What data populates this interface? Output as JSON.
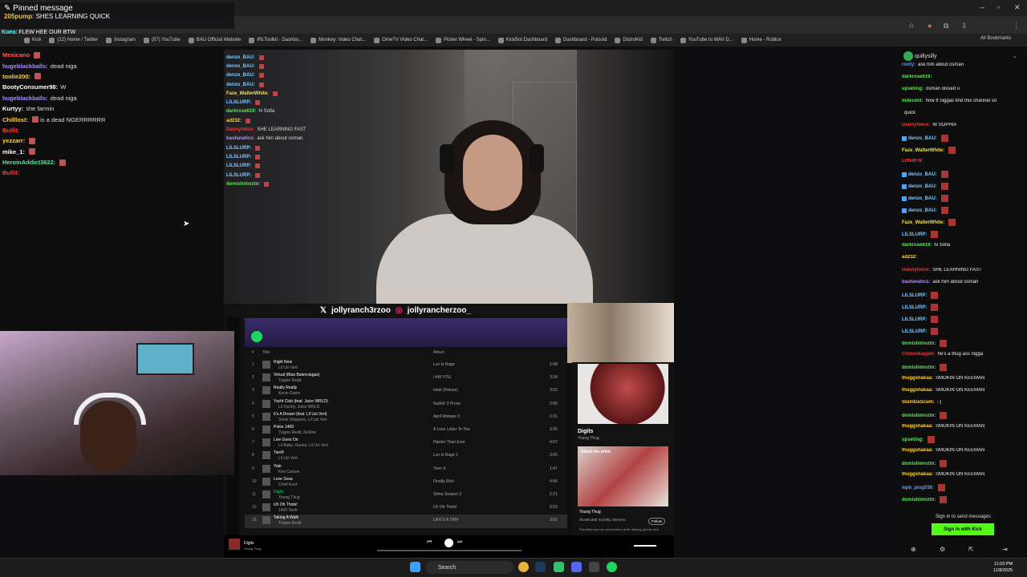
{
  "pinned": {
    "title": "Pinned message",
    "sender": "205pump",
    "text": "SHES LEARNING QUICK"
  },
  "kuea_line": {
    "sender": "Kuea:",
    "text": "FLEW HEE OUR BTW"
  },
  "bookmarks": [
    "Kick",
    "(12) Home / Twitter",
    "Instagram",
    "(57) YouTube",
    "BAU Official Website",
    "IRLToolkit - Dashbo...",
    "Monkey: Video Chat...",
    "OmeTV Video Chat...",
    "Picker Wheel - Spin...",
    "KickBot Dashboard",
    "Dashboard - Pulsoid",
    "DistroKid",
    "Twitch",
    "YouTube to WAV D...",
    "Home - Roblox"
  ],
  "all_bookmarks": "All Bookmarks",
  "left_chat": [
    {
      "name": "Mexicano",
      "text": "",
      "color": "#ff5a5a",
      "emote": true
    },
    {
      "name": "hugeblackballs:",
      "text": "dead niga",
      "color": "#a58cff",
      "emote": false
    },
    {
      "name": "toolie200:",
      "text": "",
      "color": "#ffd23a",
      "emote": true
    },
    {
      "name": "BootyConsumer98:",
      "text": "W",
      "color": "#ffffff",
      "emote": false
    },
    {
      "name": "hugeblackballs:",
      "text": "dead niga",
      "color": "#a58cff",
      "emote": false
    },
    {
      "name": "Kurtyy:",
      "text": "she farmin",
      "color": "#ffffff",
      "emote": false
    },
    {
      "name": "Chilllost:",
      "text": "is a dead NGERRRRRR",
      "color": "#ffd23a",
      "emote": true
    },
    {
      "name": "Bullit:",
      "text": "",
      "color": "#ff3b3b",
      "emote": false
    },
    {
      "name": "yezzarr:",
      "text": "",
      "color": "#ffd23a",
      "emote": true
    },
    {
      "name": "mike_1:",
      "text": "",
      "color": "#ffffff",
      "emote": true
    },
    {
      "name": "HeroinAddict3622:",
      "text": "",
      "color": "#5fe3a1",
      "emote": true
    },
    {
      "name": "Bullit:",
      "text": "",
      "color": "#ff3b3b",
      "emote": false
    }
  ],
  "overlay_chat": [
    {
      "name": "denzo_BAU:",
      "text": "",
      "color": "#7ec8ff"
    },
    {
      "name": "denzo_BAU:",
      "text": "",
      "color": "#7ec8ff"
    },
    {
      "name": "denzo_BAU:",
      "text": "",
      "color": "#7ec8ff"
    },
    {
      "name": "denzo_BAU:",
      "text": "",
      "color": "#7ec8ff"
    },
    {
      "name": "Faze_WalterWhite:",
      "text": "",
      "color": "#f0e05a"
    },
    {
      "name": "LILSLURP:",
      "text": "",
      "color": "#7ec8ff"
    },
    {
      "name": "darkrose619:",
      "text": "hi Sofia",
      "color": "#5fe35f"
    },
    {
      "name": "ad232:",
      "text": "",
      "color": "#ffd23a"
    },
    {
      "name": "Dannytwice:",
      "text": "SHE LEARNING FAST",
      "color": "#e23b3b"
    },
    {
      "name": "baufanatics:",
      "text": "ask him about osman",
      "color": "#b78cff"
    },
    {
      "name": "LILSLURP:",
      "text": "",
      "color": "#7ec8ff"
    },
    {
      "name": "LILSLURP:",
      "text": "",
      "color": "#7ec8ff"
    },
    {
      "name": "LILSLURP:",
      "text": "",
      "color": "#7ec8ff"
    },
    {
      "name": "LILSLURP:",
      "text": "",
      "color": "#7ec8ff"
    },
    {
      "name": "domishimvztn:",
      "text": "",
      "color": "#5fe35f"
    }
  ],
  "spotify_header": {
    "x_handle": "jollyranch3rzoo",
    "ig_handle": "jollyrancherzoo_"
  },
  "spotify_columns": {
    "num": "#",
    "title": "Title",
    "album": "Album"
  },
  "tracks": [
    {
      "n": "1",
      "title": "Right Now",
      "artist": "Lil Uzi Vert",
      "album": "Luv Is Rage",
      "dur": "2:08"
    },
    {
      "n": "2",
      "title": "Virtual (Blue Balenciagas)",
      "artist": "Trippie Redd",
      "album": "I AM YOU",
      "dur": "3:24"
    },
    {
      "n": "3",
      "title": "Really Really",
      "artist": "Kevin Gates",
      "album": "Islah (Deluxe)",
      "dur": "3:52"
    },
    {
      "n": "4",
      "title": "Yacht Club (feat. Juice WRLD)",
      "artist": "Lil Yachty, Juice WRLD",
      "album": "Nuthin' 2 Prove",
      "dur": "2:56"
    },
    {
      "n": "5",
      "title": "It's A Dream (feat. Lil Uzi Vert)",
      "artist": "Snow Strippers, Lil Uzi Vert",
      "album": "April Mixtape 3",
      "dur": "2:31"
    },
    {
      "n": "6",
      "title": "Poles 1469",
      "artist": "Trippie Redd, 6ix9ine",
      "album": "A Love Letter To You",
      "dur": "3:30"
    },
    {
      "n": "7",
      "title": "Live Goes On",
      "artist": "Lil Baby, Gunna, Lil Uzi Vert",
      "album": "Harder Than Ever",
      "dur": "4:07"
    },
    {
      "n": "8",
      "title": "Two®",
      "artist": "Lil Uzi Vert",
      "album": "Luv Is Rage 2",
      "dur": "3:05"
    },
    {
      "n": "9",
      "title": "Yale",
      "artist": "Ken Carson",
      "album": "Teen X",
      "dur": "1:47"
    },
    {
      "n": "10",
      "title": "Love Sosa",
      "artist": "Chief Keef",
      "album": "Finally Rich",
      "dur": "4:06"
    },
    {
      "n": "11",
      "title": "Digits",
      "artist": "Young Thug",
      "album": "Slime Season 3",
      "dur": "2:21"
    },
    {
      "n": "12",
      "title": "Uh Oh Thots!",
      "artist": "1400 Yeeh",
      "album": "Uh Oh Thots!",
      "dur": "0:53"
    },
    {
      "n": "13",
      "title": "Taking A Walk",
      "artist": "Trippie Redd",
      "album": "LIFE'S A TRIP",
      "dur": "3:52"
    }
  ],
  "now_playing": {
    "title": "Digits",
    "artist": "Young Thug",
    "about": "About the artist",
    "listeners": "29,650,600 monthly listeners",
    "follow": "Follow",
    "desc": "Flaunting hip-hop conventions while defying gender and"
  },
  "right_chat_header": "quillysilly",
  "right_chat": [
    {
      "name": "roofy:",
      "text": "ask him about osman",
      "color": "#5f9dff",
      "emote": false
    },
    {
      "name": "darkrose619:",
      "text": "",
      "color": "#5fe35f",
      "emote": false
    },
    {
      "name": "upseting:",
      "text": "osman dissed u",
      "color": "#5fe35f",
      "emote": false
    },
    {
      "name": "Indecent:",
      "text": "how tf niggas find this channel so",
      "color": "#5fe35f",
      "emote": false
    },
    {
      "name": "",
      "text": "quick",
      "color": "#ffffff",
      "emote": false
    },
    {
      "name": "Dannytwice:",
      "text": "W SOPHIA",
      "color": "#e23b3b",
      "emote": false
    },
    {
      "name": "denzo_BAU:",
      "text": "",
      "color": "#7ec8ff",
      "emote": true
    },
    {
      "name": "Faze_WalterWhite:",
      "text": "",
      "color": "#f0e05a",
      "emote": true
    },
    {
      "name": "LiftedFN:",
      "text": "",
      "color": "#ff3b3b",
      "emote": false
    },
    {
      "name": "denzo_BAU:",
      "text": "",
      "color": "#7ec8ff",
      "emote": true
    },
    {
      "name": "denzo_BAU:",
      "text": "",
      "color": "#7ec8ff",
      "emote": true
    },
    {
      "name": "denzo_BAU:",
      "text": "",
      "color": "#7ec8ff",
      "emote": true
    },
    {
      "name": "denzo_BAU:",
      "text": "",
      "color": "#7ec8ff",
      "emote": true
    },
    {
      "name": "Faze_WalterWhite:",
      "text": "",
      "color": "#f0e05a",
      "emote": true
    },
    {
      "name": "LILSLURP:",
      "text": "",
      "color": "#7ec8ff",
      "emote": true
    },
    {
      "name": "darkrose619:",
      "text": "hi Sofia",
      "color": "#5fe35f",
      "emote": false
    },
    {
      "name": "ad232:",
      "text": "",
      "color": "#ffd23a",
      "emote": false
    },
    {
      "name": "Dannytwice:",
      "text": "SHE LEARNING FAST",
      "color": "#e23b3b",
      "emote": false
    },
    {
      "name": "baufanatics:",
      "text": "ask him about osman",
      "color": "#b78cff",
      "emote": false
    },
    {
      "name": "LILSLURP:",
      "text": "",
      "color": "#7ec8ff",
      "emote": true
    },
    {
      "name": "LILSLURP:",
      "text": "",
      "color": "#7ec8ff",
      "emote": true
    },
    {
      "name": "LILSLURP:",
      "text": "",
      "color": "#7ec8ff",
      "emote": true
    },
    {
      "name": "LILSLURP:",
      "text": "",
      "color": "#7ec8ff",
      "emote": true
    },
    {
      "name": "domishimvztn:",
      "text": "",
      "color": "#5fe35f",
      "emote": true
    },
    {
      "name": "Chinookapple:",
      "text": "he's a thug ass nigga",
      "color": "#e23b3b",
      "emote": false
    },
    {
      "name": "domishimvztn:",
      "text": "",
      "color": "#5fe35f",
      "emote": true
    },
    {
      "name": "thuggshakaa:",
      "text": "SMOKIN ON KEEMAN",
      "color": "#ffd23a",
      "emote": false
    },
    {
      "name": "thuggshakaa:",
      "text": "SMOKIN ON KEEMAN",
      "color": "#ffd23a",
      "emote": false
    },
    {
      "name": "SlumDaScum:",
      "text": ":-)",
      "color": "#ffd23a",
      "emote": false
    },
    {
      "name": "domishimvztn:",
      "text": "",
      "color": "#5fe35f",
      "emote": true
    },
    {
      "name": "thuggshakaa:",
      "text": "SMOKIN ON KEEMAN",
      "color": "#ffd23a",
      "emote": false
    },
    {
      "name": "upseting:",
      "text": "",
      "color": "#5fe35f",
      "emote": true
    },
    {
      "name": "thuggshakaa:",
      "text": "SMOKIN ON KEEMAN",
      "color": "#ffd23a",
      "emote": false
    },
    {
      "name": "domishimvztn:",
      "text": "",
      "color": "#5fe35f",
      "emote": true
    },
    {
      "name": "thuggshakaa:",
      "text": "SMOKIN ON KEEMAN",
      "color": "#ffd23a",
      "emote": false
    },
    {
      "name": "wpb_plug556:",
      "text": "",
      "color": "#5f9dff",
      "emote": true
    },
    {
      "name": "domishimvztn:",
      "text": "",
      "color": "#5fe35f",
      "emote": true
    }
  ],
  "signin": {
    "text": "Sign in to send messages",
    "button": "Sign in with Kick"
  },
  "taskbar": {
    "search": "Search",
    "time": "11:03 PM",
    "date": "11/8/2025"
  }
}
